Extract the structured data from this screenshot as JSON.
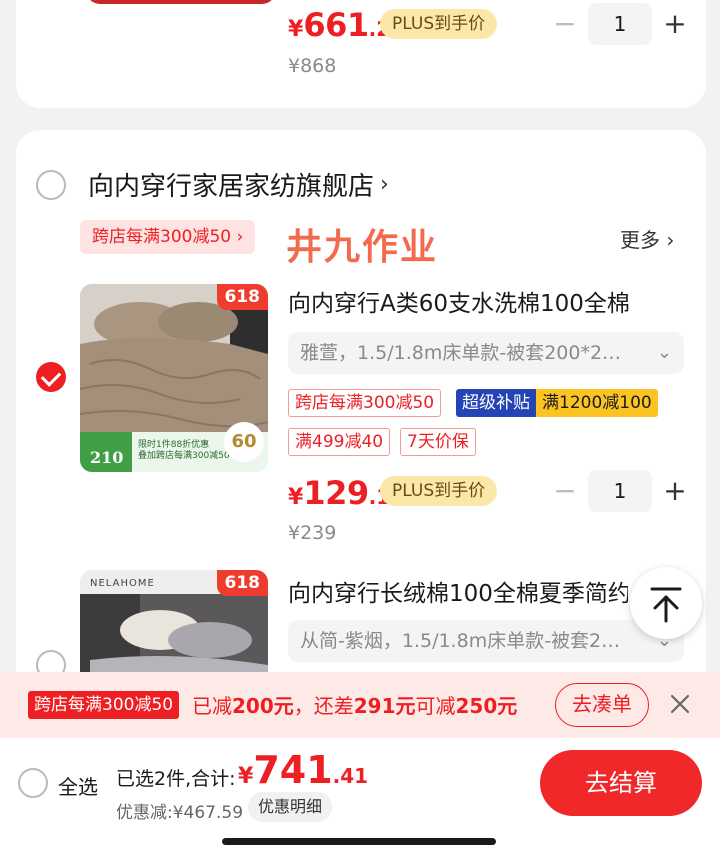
{
  "prev_item": {
    "price_currency": "¥",
    "price_int": "661",
    "price_dec": ".2",
    "plus_label": "PLUS到手价",
    "original_price": "¥868",
    "quantity": "1",
    "minus": "−",
    "plus": "+"
  },
  "store": {
    "name": "向内穿行家居家纺旗舰店",
    "chevron": "›",
    "promo": "跨店每满300减50 ›",
    "watermark": "井九作业",
    "more": "更多 ›"
  },
  "item1": {
    "badge": "618",
    "title": "向内穿行A类60支水洗棉100全棉",
    "sku": "雅萱，1.5/1.8m床单款-被套200*2…",
    "sku_chev": "⌄",
    "tag1": "跨店每满300减50",
    "subsidy_a": "超级补贴",
    "subsidy_b": "满1200减100",
    "tag2": "满499减40",
    "tag3": "7天价保",
    "price_currency": "¥",
    "price_int": "129",
    "price_dec": ".1",
    "plus_label": "PLUS到手价",
    "original_price": "¥239",
    "quantity": "1",
    "minus": "−",
    "plus": "+",
    "thumb_price": "210",
    "thumb_60": "60",
    "thumb_text1": "限时1件88折优惠",
    "thumb_text2": "叠加跨店每满300减50"
  },
  "item2": {
    "badge": "618",
    "brand": "NELAHOME",
    "title": "向内穿行长绒棉100全棉夏季简约",
    "sku": "从简-紫烟，1.5/1.8m床单款-被套2…",
    "sku_chev": "⌄"
  },
  "promo_bar": {
    "label": "跨店每满300减50",
    "msg_1": "已减",
    "msg_2": "200元",
    "msg_3": "，还差",
    "msg_4": "291元",
    "msg_5": "可减",
    "msg_6": "250元",
    "button": "去凑单"
  },
  "checkout": {
    "select_all": "全选",
    "selected": "已选2件,合计:",
    "total_currency": "¥",
    "total_int": "741",
    "total_dec": ".41",
    "discount": "优惠减:¥467.59",
    "detail": "优惠明细",
    "pay": "去结算"
  },
  "colors": {
    "accent_red": "#ee1f23",
    "plus_gold": "#fbe8a8",
    "subsidy_blue": "#2443b5",
    "subsidy_yellow": "#fbc423"
  }
}
